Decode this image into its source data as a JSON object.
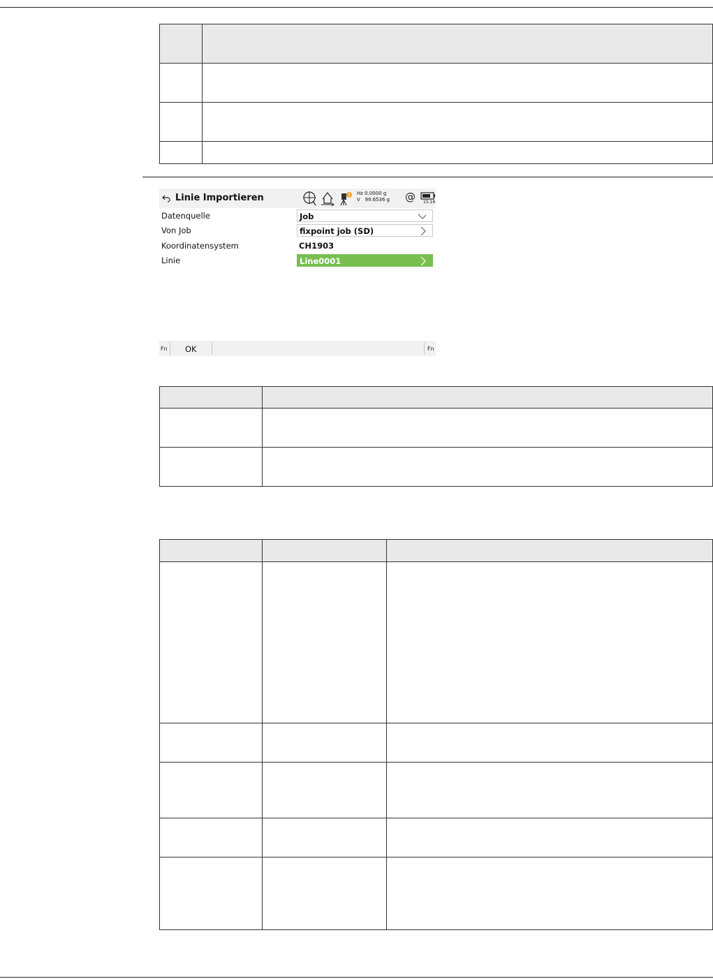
{
  "screen": {
    "title": "Linie Importieren",
    "status": {
      "hz": "Hz 0.0000 g",
      "v": "V   99.6536 g",
      "time": "15:16",
      "icons": [
        "target-icon",
        "home-arrow-icon",
        "instrument-warning-icon",
        "at-icon",
        "battery-icon"
      ]
    },
    "fields": [
      {
        "label": "Datenquelle",
        "value": "Job",
        "control": "dropdown"
      },
      {
        "label": "Von Job",
        "value": "fixpoint job (SD)",
        "control": "list"
      },
      {
        "label": "Koordinatensystem",
        "value": "CH1903",
        "control": "readonly"
      },
      {
        "label": "Linie",
        "value": "Line0001",
        "control": "list-selected"
      }
    ],
    "softkeys": {
      "fn_left": "Fn",
      "ok": "OK",
      "fn_right": "Fn"
    }
  },
  "colors": {
    "selected_field": "#78bf4f",
    "bar_background": "#f1f1f1",
    "table_header": "#e9e9e9"
  }
}
